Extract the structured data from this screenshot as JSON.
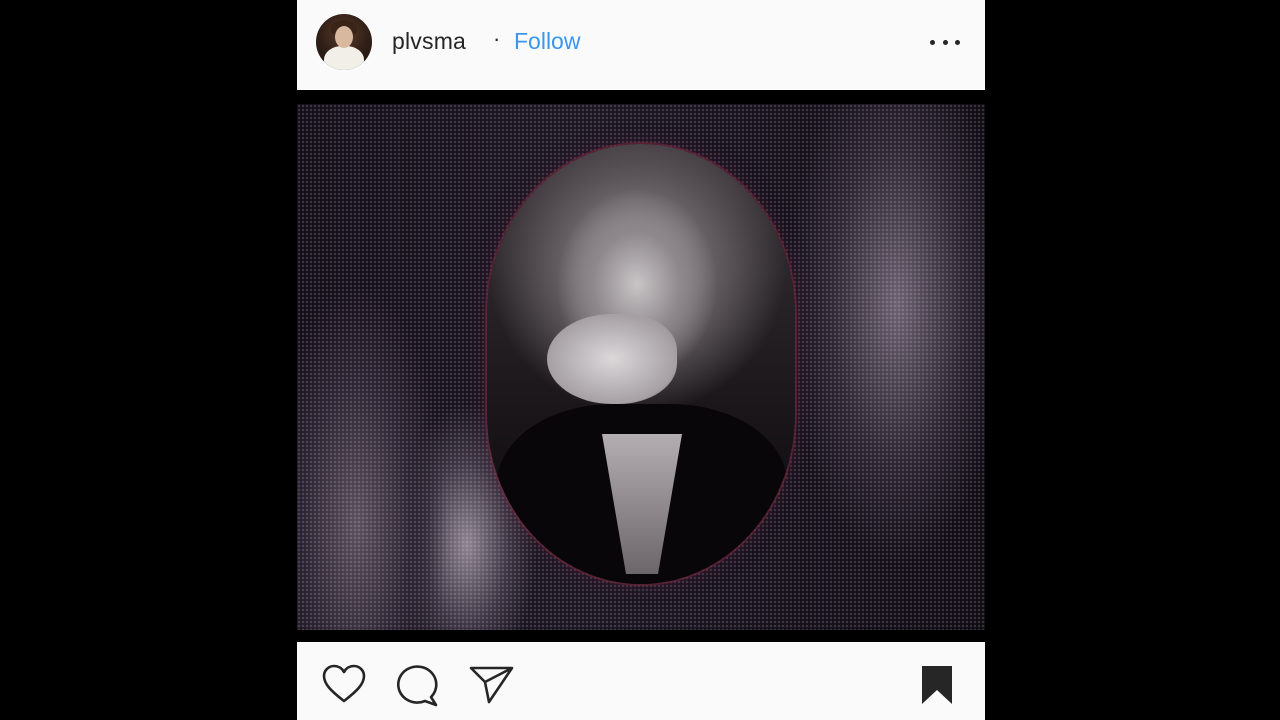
{
  "header": {
    "username": "plvsma",
    "separator": "·",
    "follow_label": "Follow"
  },
  "media": {
    "type": "video",
    "description_icon": "photo-collage"
  },
  "actions": {
    "like_icon": "heart-icon",
    "comment_icon": "comment-icon",
    "share_icon": "send-icon",
    "save_icon": "bookmark-icon"
  },
  "colors": {
    "follow": "#3897f0",
    "bar_background": "#fafafa",
    "text": "#262626"
  }
}
